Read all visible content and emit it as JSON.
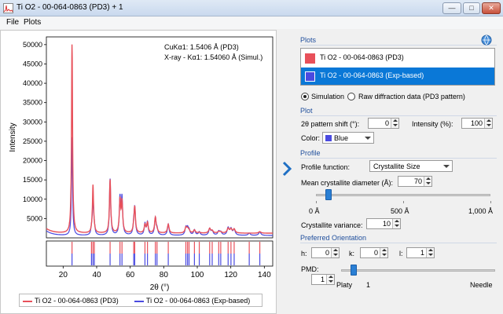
{
  "window": {
    "title": "Ti O2 - 00-064-0863 (PD3) + 1",
    "buttons": {
      "minimize": "—",
      "maximize": "□",
      "close": "✕"
    }
  },
  "menu": {
    "items": [
      "File",
      "Plots"
    ]
  },
  "chart_data": {
    "type": "line",
    "xlabel": "2θ (°)",
    "ylabel": "Intensity",
    "xlim": [
      10,
      145
    ],
    "ylim": [
      0,
      52000
    ],
    "x_ticks": [
      20,
      40,
      60,
      80,
      100,
      120,
      140
    ],
    "y_ticks": [
      5000,
      10000,
      15000,
      20000,
      25000,
      30000,
      35000,
      40000,
      45000,
      50000
    ],
    "annotations": [
      "CuKα1: 1.5406 Å (PD3)",
      "X-ray - Kα1: 1.54060 Å (Simul.)"
    ],
    "baseline": {
      "PD3": 1200,
      "Exp-based": 600
    },
    "series": [
      {
        "name": "Ti O2 - 00-064-0863 (PD3)",
        "color": "#e8505a",
        "peaks": [
          {
            "x": 25.3,
            "y": 50000
          },
          {
            "x": 36.9,
            "y": 1500
          },
          {
            "x": 37.8,
            "y": 13500
          },
          {
            "x": 38.6,
            "y": 1800
          },
          {
            "x": 48.0,
            "y": 15000
          },
          {
            "x": 53.9,
            "y": 9500
          },
          {
            "x": 55.1,
            "y": 9000
          },
          {
            "x": 62.1,
            "y": 2200
          },
          {
            "x": 62.7,
            "y": 7800
          },
          {
            "x": 68.8,
            "y": 3300
          },
          {
            "x": 70.3,
            "y": 3800
          },
          {
            "x": 75.0,
            "y": 5200
          },
          {
            "x": 76.0,
            "y": 1800
          },
          {
            "x": 82.7,
            "y": 3500
          },
          {
            "x": 93.2,
            "y": 2600
          },
          {
            "x": 94.2,
            "y": 2200
          },
          {
            "x": 95.1,
            "y": 1800
          },
          {
            "x": 98.3,
            "y": 2000
          },
          {
            "x": 101.2,
            "y": 1400
          },
          {
            "x": 107.4,
            "y": 2400
          },
          {
            "x": 108.9,
            "y": 1800
          },
          {
            "x": 112.8,
            "y": 1600
          },
          {
            "x": 114.0,
            "y": 1500
          },
          {
            "x": 118.4,
            "y": 2400
          },
          {
            "x": 120.1,
            "y": 2200
          },
          {
            "x": 122.0,
            "y": 2200
          },
          {
            "x": 131.0,
            "y": 1200
          },
          {
            "x": 137.3,
            "y": 1600
          }
        ]
      },
      {
        "name": "Ti O2 - 00-064-0863 (Exp-based)",
        "color": "#4a4ae0",
        "peaks": [
          {
            "x": 25.3,
            "y": 26000
          },
          {
            "x": 36.9,
            "y": 2000
          },
          {
            "x": 37.8,
            "y": 10500
          },
          {
            "x": 38.6,
            "y": 2500
          },
          {
            "x": 48.0,
            "y": 15200
          },
          {
            "x": 53.9,
            "y": 10000
          },
          {
            "x": 55.1,
            "y": 10000
          },
          {
            "x": 62.1,
            "y": 2500
          },
          {
            "x": 62.7,
            "y": 7500
          },
          {
            "x": 68.8,
            "y": 3500
          },
          {
            "x": 70.3,
            "y": 3900
          },
          {
            "x": 75.0,
            "y": 5000
          },
          {
            "x": 76.0,
            "y": 2000
          },
          {
            "x": 82.7,
            "y": 3500
          },
          {
            "x": 93.2,
            "y": 2500
          },
          {
            "x": 94.2,
            "y": 2200
          },
          {
            "x": 95.1,
            "y": 1800
          },
          {
            "x": 98.3,
            "y": 2000
          },
          {
            "x": 101.2,
            "y": 1500
          },
          {
            "x": 107.4,
            "y": 2300
          },
          {
            "x": 108.9,
            "y": 1700
          },
          {
            "x": 112.8,
            "y": 1600
          },
          {
            "x": 114.0,
            "y": 1400
          },
          {
            "x": 118.4,
            "y": 2500
          },
          {
            "x": 120.1,
            "y": 2200
          },
          {
            "x": 122.0,
            "y": 2100
          },
          {
            "x": 131.0,
            "y": 1200
          },
          {
            "x": 137.3,
            "y": 1500
          }
        ]
      }
    ]
  },
  "legend": {
    "entries": [
      {
        "label": "Ti O2 - 00-064-0863 (PD3)",
        "color": "#e8505a"
      },
      {
        "label": "Ti O2 - 00-064-0863 (Exp-based)",
        "color": "#4a4ae0"
      }
    ]
  },
  "panel": {
    "plots_header": "Plots",
    "plot_list": [
      {
        "label": "Ti O2 - 00-064-0863 (PD3)",
        "color": "#e8505a",
        "selected": false
      },
      {
        "label": "Ti O2 - 00-064-0863 (Exp-based)",
        "color": "#4a4ae0",
        "selected": true
      }
    ],
    "mode": {
      "simulation": "Simulation",
      "raw": "Raw diffraction data (PD3 pattern)",
      "selected": "simulation"
    },
    "plot_section": {
      "title": "Plot",
      "shift_label": "2θ pattern shift (°):",
      "shift_value": "0",
      "intensity_label": "Intensity (%):",
      "intensity_value": "100",
      "color_label": "Color:",
      "color_value": "Blue",
      "color_swatch": "#4a4ae0"
    },
    "profile_section": {
      "title": "Profile",
      "function_label": "Profile function:",
      "function_value": "Crystallite Size",
      "diameter_label": "Mean crystallite diameter (Å):",
      "diameter_value": "70",
      "diameter_fraction": 0.07,
      "scale": [
        "0 Å",
        "500 Å",
        "1,000 Å"
      ],
      "variance_label": "Crystallite variance:",
      "variance_value": "10"
    },
    "orientation_section": {
      "title": "Preferred Orientation",
      "h_label": "h:",
      "h_value": "0",
      "k_label": "k:",
      "k_value": "0",
      "l_label": "l:",
      "l_value": "1",
      "pmd_label": "PMD:",
      "pmd_value": "1",
      "pmd_scale": [
        "Platy",
        "1",
        "Needle"
      ],
      "pmd_fraction": 0.08
    }
  }
}
